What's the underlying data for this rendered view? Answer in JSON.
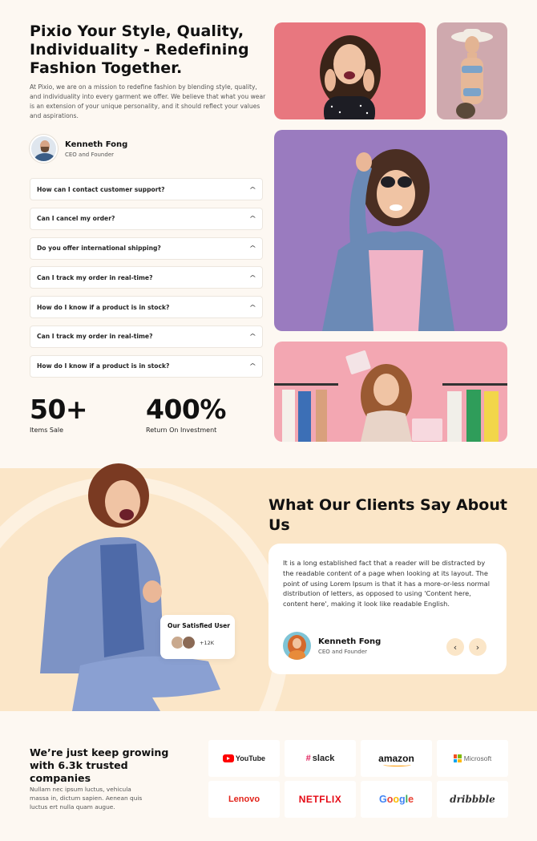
{
  "about": {
    "title": "Pixio Your Style, Quality, Individuality - Redefining Fashion Together.",
    "description": "At Pixio, we are on a mission to redefine fashion by blending style, quality, and individuality into every garment we offer. We believe that what you wear is an extension of your unique personality, and it should reflect your values and aspirations.",
    "author": {
      "name": "Kenneth Fong",
      "role": "CEO and Founder"
    }
  },
  "faq": [
    {
      "question": "How can I contact customer support?"
    },
    {
      "question": "Can I cancel my order?"
    },
    {
      "question": "Do you offer international shipping?"
    },
    {
      "question": "Can I track my order in real-time?"
    },
    {
      "question": "How do I know if a product is in stock?"
    },
    {
      "question": "Can I track my order in real-time?"
    },
    {
      "question": "How do I know if a product is in stock?"
    }
  ],
  "stats": [
    {
      "value": "50+",
      "label": "Items Sale"
    },
    {
      "value": "400%",
      "label": "Return On Investment"
    }
  ],
  "testimonials": {
    "title": "What Our Clients Say About Us",
    "text": "It is a long established fact that a reader will be distracted by the readable content of a page when looking at its layout. The point of using Lorem Ipsum is that it has a more-or-less normal distribution of letters, as opposed to using 'Content here, content here', making it look like readable English.",
    "author": {
      "name": "Kenneth Fong",
      "role": "CEO and Founder"
    },
    "satisfied": {
      "title": "Our Satisfied User",
      "count": "+12K"
    }
  },
  "trusted": {
    "title": "We’re just keep growing with 6.3k trusted companies",
    "description": "Nullam nec ipsum luctus, vehicula massa in, dictum sapien. Aenean quis luctus ert nulla quam augue.",
    "logos": {
      "youtube": "YouTube",
      "slack": "slack",
      "amazon": "amazon",
      "microsoft": "Microsoft",
      "lenovo": "Lenovo",
      "netflix": "NETFLIX",
      "google": "Google",
      "dribbble": "dribbble"
    }
  },
  "colors": {
    "page_bg": "#fdf8f2",
    "testimonial_bg": "#fbe6c8",
    "photo_pink": "#e8777f",
    "photo_purple": "#9a7bbf",
    "photo_rose": "#f3a7b2"
  },
  "icons": {
    "faq_toggle": "chevron-up-icon",
    "prev": "chevron-left-icon",
    "next": "chevron-right-icon"
  }
}
